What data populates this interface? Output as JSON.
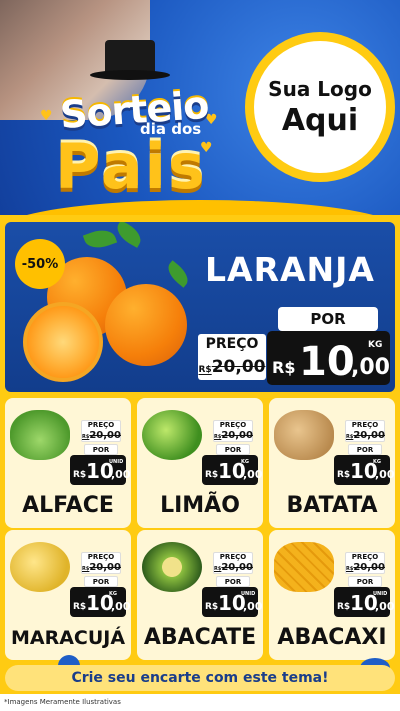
{
  "hero": {
    "title_top": "Sorteio",
    "title_mid": "dia dos",
    "title_bottom": "Pais",
    "logo_line1": "Sua Logo",
    "logo_line2": "Aqui"
  },
  "featured": {
    "discount_badge": "-50%",
    "name": "LARANJA",
    "preco_label": "PREÇO",
    "old_currency": "R$",
    "old_price": "20,00",
    "por_label": "POR",
    "currency": "R$",
    "price_int": "10",
    "price_dec": ",00",
    "unit": "KG"
  },
  "products": [
    {
      "name": "ALFACE",
      "preco_label": "PREÇO",
      "old_currency": "R$",
      "old_price": "20,00",
      "por_label": "POR",
      "currency": "R$",
      "price_int": "10",
      "price_dec": ",00",
      "unit": "UNID"
    },
    {
      "name": "LIMÃO",
      "preco_label": "PREÇO",
      "old_currency": "R$",
      "old_price": "20,00",
      "por_label": "POR",
      "currency": "R$",
      "price_int": "10",
      "price_dec": ",00",
      "unit": "KG"
    },
    {
      "name": "BATATA",
      "preco_label": "PREÇO",
      "old_currency": "R$",
      "old_price": "20,00",
      "por_label": "POR",
      "currency": "R$",
      "price_int": "10",
      "price_dec": ",00",
      "unit": "KG"
    },
    {
      "name": "MARACUJÁ",
      "preco_label": "PREÇO",
      "old_currency": "R$",
      "old_price": "20,00",
      "por_label": "POR",
      "currency": "R$",
      "price_int": "10",
      "price_dec": ",00",
      "unit": "KG"
    },
    {
      "name": "ABACATE",
      "preco_label": "PREÇO",
      "old_currency": "R$",
      "old_price": "20,00",
      "por_label": "POR",
      "currency": "R$",
      "price_int": "10",
      "price_dec": ",00",
      "unit": "UNID"
    },
    {
      "name": "ABACAXI",
      "preco_label": "PREÇO",
      "old_currency": "R$",
      "old_price": "20,00",
      "por_label": "POR",
      "currency": "R$",
      "price_int": "10",
      "price_dec": ",00",
      "unit": "UNID"
    }
  ],
  "cta": "Crie seu encarte com este tema!",
  "disclaimer": "*Imagens Meramente Ilustrativas",
  "colors": {
    "brand_blue": "#1a4ea8",
    "accent_yellow": "#ffcb12",
    "price_black": "#111111",
    "card_bg": "#fff7d6"
  }
}
